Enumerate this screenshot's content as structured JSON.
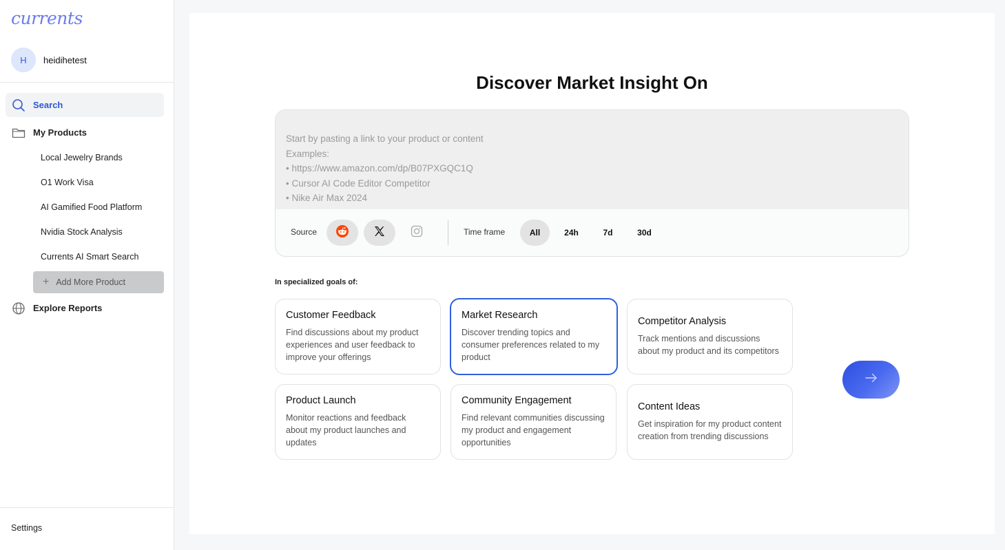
{
  "app": {
    "logo_text": "currents"
  },
  "user": {
    "avatar_letter": "H",
    "name": "heidihetest"
  },
  "sidebar": {
    "search_label": "Search",
    "products_label": "My Products",
    "products": [
      "Local Jewelry Brands",
      "O1 Work Visa",
      "AI Gamified Food Platform",
      "Nvidia Stock Analysis",
      "Currents AI Smart Search"
    ],
    "add_more_label": "Add More Product",
    "explore_label": "Explore Reports",
    "settings_label": "Settings"
  },
  "main": {
    "heading": "Discover Market Insight On",
    "search": {
      "placeholder_lines": [
        "Start by pasting a link to your product or content",
        "Examples:",
        "• https://www.amazon.com/dp/B07PXGQC1Q",
        "• Cursor AI Code Editor Competitor",
        "• Nike Air Max 2024"
      ],
      "source_label": "Source",
      "sources": [
        "reddit-icon",
        "x-icon",
        "instagram-icon"
      ],
      "timeframe_label": "Time frame",
      "timeframes": [
        "All",
        "24h",
        "7d",
        "30d"
      ],
      "selected_timeframe": "All"
    },
    "goals_label": "In specialized goals of:",
    "goals": [
      {
        "title": "Customer Feedback",
        "desc": "Find discussions about my product experiences and user feedback to improve your offerings"
      },
      {
        "title": "Market Research",
        "desc": "Discover trending topics and consumer preferences related to my product",
        "selected": true
      },
      {
        "title": "Competitor Analysis",
        "desc": "Track mentions and discussions about my product and its competitors"
      },
      {
        "title": "Product Launch",
        "desc": "Monitor reactions and feedback about my product launches and updates"
      },
      {
        "title": "Community Engagement",
        "desc": "Find relevant communities discussing my product and engagement opportunities"
      },
      {
        "title": "Content Ideas",
        "desc": "Get inspiration for my product content creation from trending discussions"
      }
    ]
  },
  "colors": {
    "accent": "#2f56d6",
    "reddit": "#ff4500",
    "selected_border": "#2f5fdc"
  }
}
